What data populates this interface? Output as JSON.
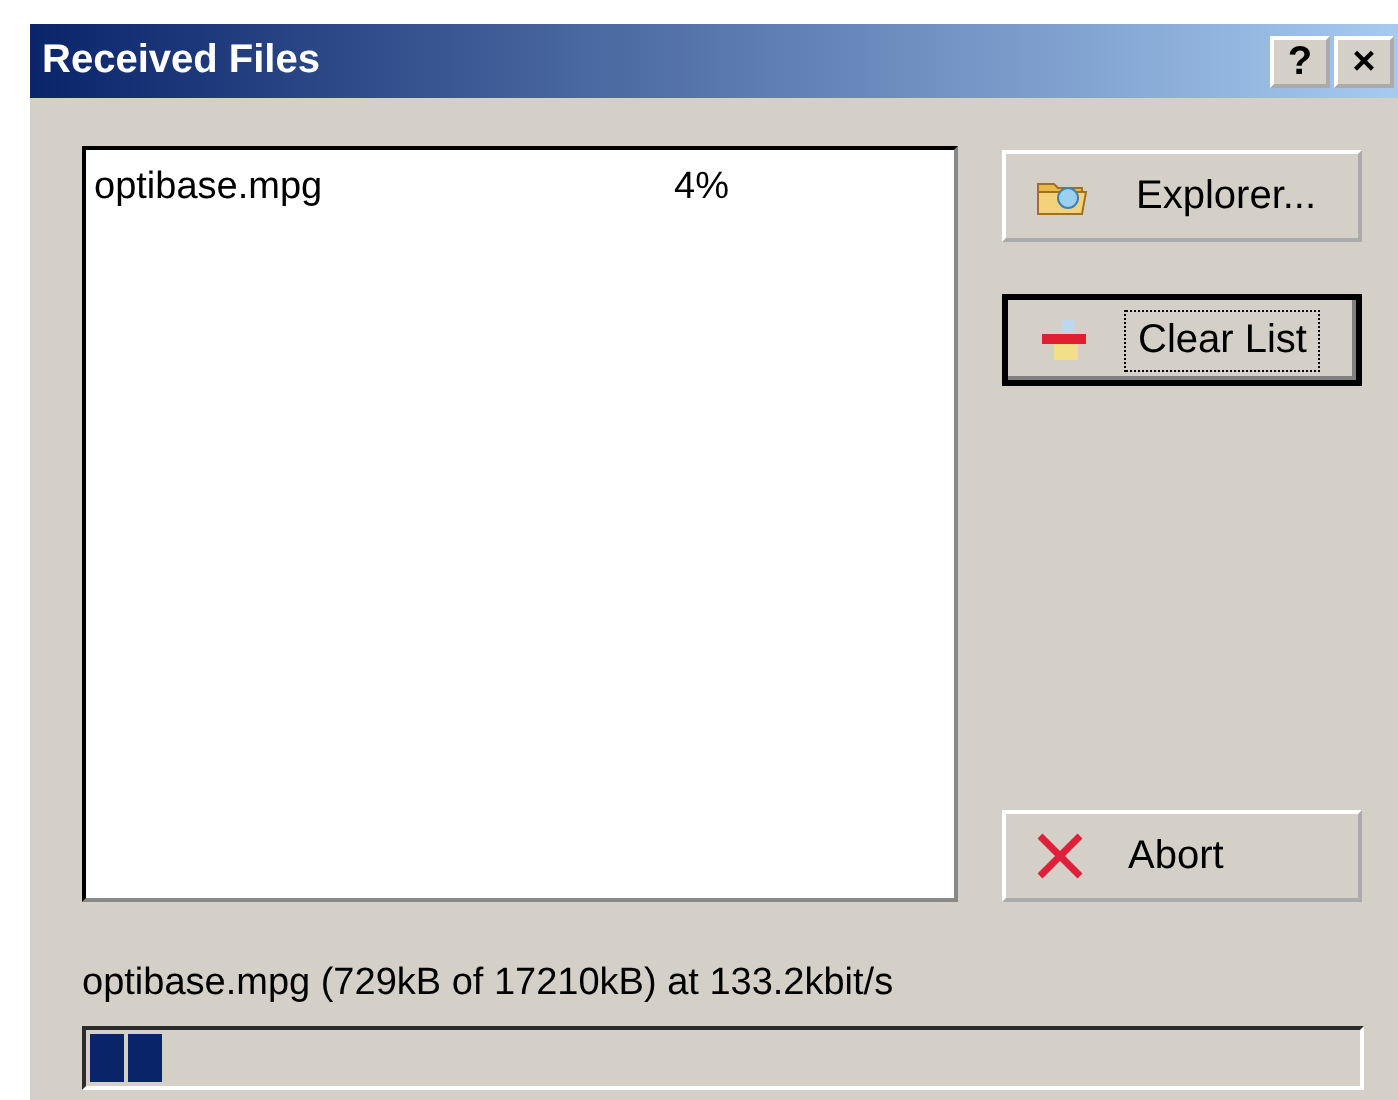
{
  "window": {
    "title": "Received Files",
    "help_button": "?",
    "close_button": "×"
  },
  "files": [
    {
      "name": "optibase.mpg",
      "progress": "4%",
      "selected": false
    }
  ],
  "buttons": [
    {
      "kind": "explorer",
      "label": "Explorer...",
      "focused": false
    },
    {
      "kind": "clear",
      "label": "Clear List",
      "focused": true
    },
    {
      "kind": "abort",
      "label": "Abort",
      "focused": false
    }
  ],
  "status": "optibase.mpg (729kB of 17210kB) at 133.2kbit/s",
  "transfer": {
    "level": 0.06
  }
}
